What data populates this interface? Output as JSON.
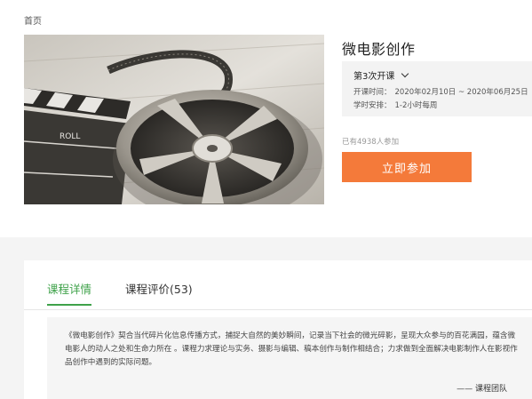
{
  "breadcrumb": {
    "home": "首页"
  },
  "course": {
    "title": "微电影创作",
    "cover_label_left": "",
    "cover_text": "ROLL"
  },
  "session": {
    "selected": "第3次开课",
    "time_label": "开课时间：",
    "time_value": "2020年02月10日 ~ 2020年06月25日",
    "schedule_label": "学时安排：",
    "schedule_value": "1-2小时每周"
  },
  "enrolled_text": "已有4938人参加",
  "join_label": "立即参加",
  "tabs": [
    {
      "label": "课程详情",
      "active": true
    },
    {
      "label": "课程评价(53)",
      "active": false
    }
  ],
  "description": {
    "text": "《微电影创作》契合当代碎片化信息传播方式，捕捉大自然的美妙瞬间，记录当下社会的微光碎影，呈现大众参与的百花满园，蕴含微电影人的动人之处和生命力所在 。课程力求理论与实务、摄影与编辑、稿本创作与制作相结合；力求做到全面解决电影制作人在影视作品创作中遇到的实际问题。",
    "signature": "—— 课程团队"
  },
  "colors": {
    "accent_green": "#3fa24a",
    "button_orange": "#f47a3a"
  }
}
